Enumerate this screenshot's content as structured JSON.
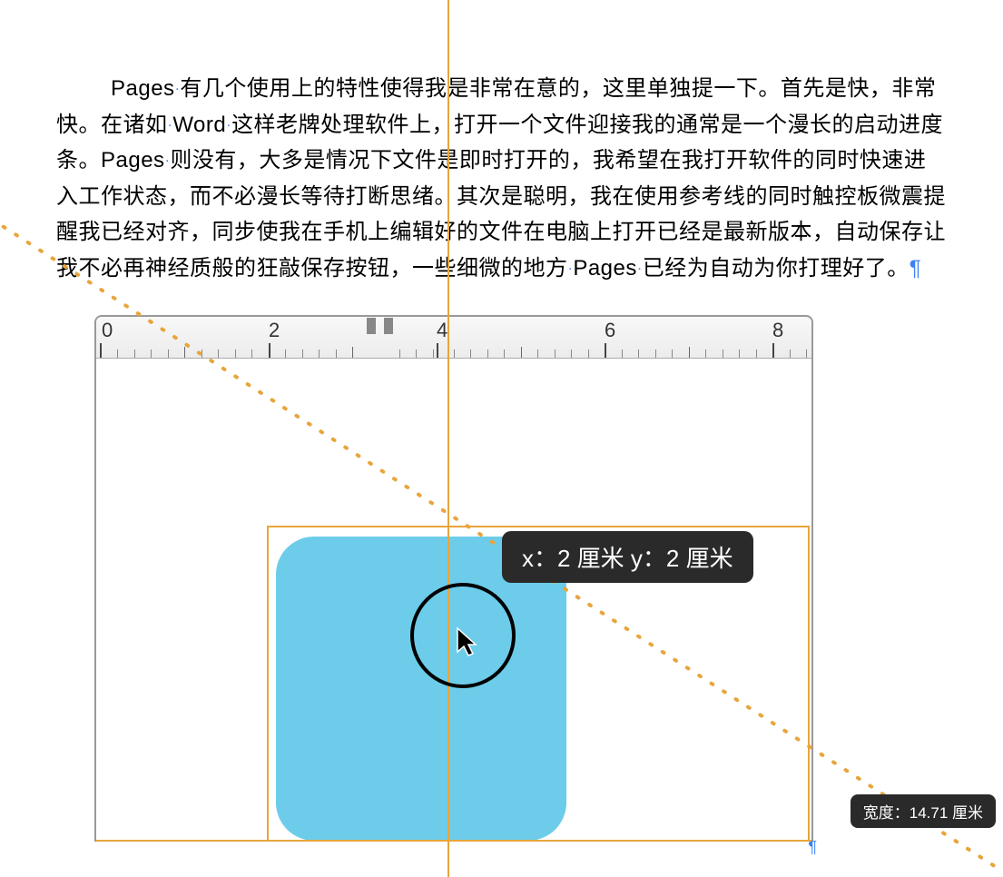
{
  "paragraph": {
    "text_parts": [
      "Pages",
      "有几个使用上的特性使得我是非常在意的，这里单独提一下。首先是快，非常快。在诸如",
      "Word",
      "这样老牌处理软件上，打开一个文件迎接我的通常是一个漫长的启动进度条。",
      "Pages",
      "则没有，大多是情况下文件是即时打开的，我希望在我打开软件的同时快速进入工作状态，而不必漫长等待打断思绪。其次是聪明，我在使用参考线的同时触控板微震提醒我已经对齐，同步使我在手机上编辑好的文件在电脑上打开已经是最新版本，自动保存让我不必再神经质般的狂敲保存按钮，一些细微的地方",
      "Pages",
      "已经为自动为你打理好了。"
    ]
  },
  "ruler": {
    "labels": [
      "0",
      "2",
      "4",
      "6",
      "8"
    ]
  },
  "position_tooltip": {
    "text": "x：2 厘米  y：2 厘米"
  },
  "width_tooltip": {
    "text": "宽度：14.71 厘米"
  }
}
